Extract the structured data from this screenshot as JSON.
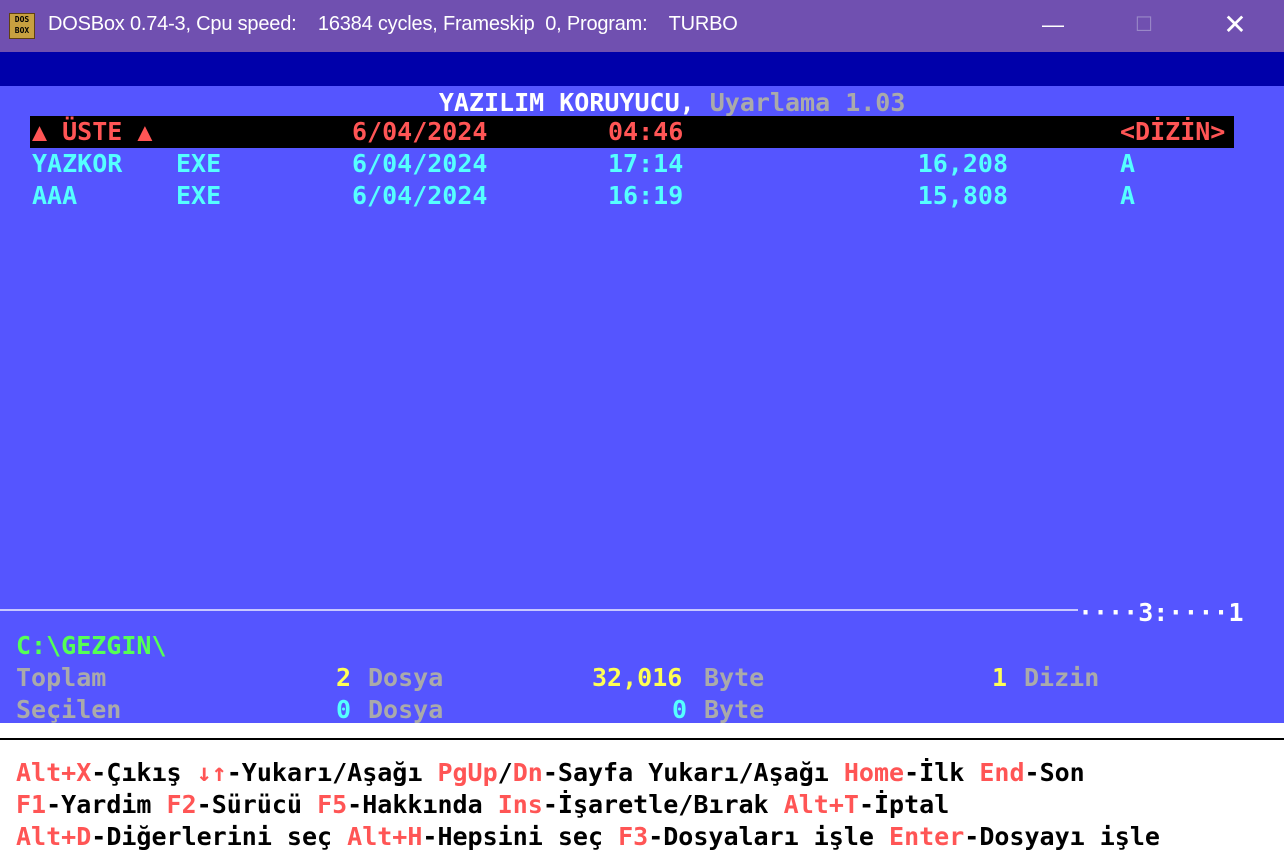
{
  "window": {
    "app_icon_text": "DOS BOX",
    "title": "DOSBox 0.74-3, Cpu speed:    16384 cycles, Frameskip  0, Program:    TURBO",
    "minimize": "—",
    "maximize": "☐",
    "close": "✕"
  },
  "header": {
    "title": "YAZILIM KORUYUCU,",
    "version": " Uyarlama 1.03"
  },
  "files": [
    {
      "name": "▲ ÜSTE ▲",
      "ext": "",
      "date": "6/04/2024",
      "time": "04:46",
      "size": "",
      "attr": "<DİZİN>",
      "selected": true
    },
    {
      "name": "YAZKOR",
      "ext": "EXE",
      "date": "6/04/2024",
      "time": "17:14",
      "size": "16,208",
      "attr": "A",
      "selected": false
    },
    {
      "name": "AAA",
      "ext": "EXE",
      "date": "6/04/2024",
      "time": "16:19",
      "size": "15,808",
      "attr": "A",
      "selected": false
    }
  ],
  "separator": {
    "indicator": "····3:····1"
  },
  "status": {
    "path": "C:\\GEZGIN\\",
    "total_label": "Toplam",
    "total_files": "2",
    "total_files_label": "Dosya",
    "total_bytes": "32,016",
    "total_bytes_label": "Byte",
    "dirs": "1",
    "dirs_label": "Dizin",
    "selected_label": "Seçilen",
    "selected_files": "0",
    "selected_files_label": "Dosya",
    "selected_bytes": "0",
    "selected_bytes_label": "Byte"
  },
  "footer": {
    "line1": [
      {
        "key": "Alt+X",
        "text": "-Çıkış "
      },
      {
        "key": "↓↑",
        "text": "-Yukarı/Aşağı "
      },
      {
        "key": "PgUp",
        "text": "/"
      },
      {
        "key": "Dn",
        "text": "-Sayfa Yukarı/Aşağı "
      },
      {
        "key": "Home",
        "text": "-İlk "
      },
      {
        "key": "End",
        "text": "-Son"
      }
    ],
    "line2": [
      {
        "key": "F1",
        "text": "-Yardim "
      },
      {
        "key": "F2",
        "text": "-Sürücü "
      },
      {
        "key": "F5",
        "text": "-Hakkında "
      },
      {
        "key": "Ins",
        "text": "-İşaretle/Bırak "
      },
      {
        "key": "Alt+T",
        "text": "-İptal"
      }
    ],
    "line3": [
      {
        "key": "Alt+D",
        "text": "-Diğerlerini seç "
      },
      {
        "key": "Alt+H",
        "text": "-Hepsini seç "
      },
      {
        "key": "F3",
        "text": "-Dosyaları işle "
      },
      {
        "key": "Enter",
        "text": "-Dosyayı işle"
      }
    ]
  },
  "colors": {
    "screen_bg": "#5555ff",
    "header_bg": "#0000aa",
    "titlebar_bg": "#7050b0",
    "key_color": "#ff5555"
  }
}
